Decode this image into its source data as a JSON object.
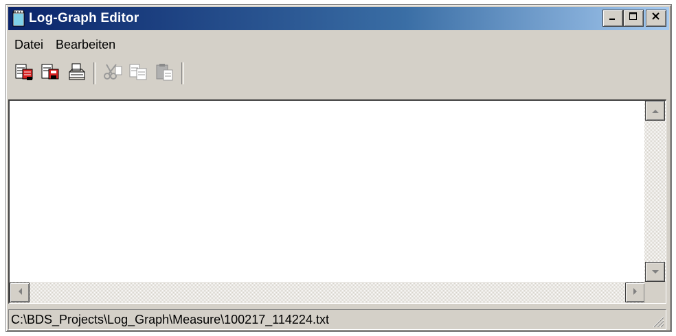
{
  "window": {
    "title": "Log-Graph Editor",
    "title_gradient": [
      "#0a246a",
      "#a6caf0"
    ],
    "controls": {
      "minimize": "minimize-icon",
      "maximize": "maximize-icon",
      "close": "close-icon"
    }
  },
  "menubar": {
    "items": [
      {
        "label": "Datei"
      },
      {
        "label": "Bearbeiten"
      }
    ]
  },
  "toolbar": {
    "groups": [
      [
        {
          "icon": "new-file-icon",
          "enabled": true
        },
        {
          "icon": "save-file-icon",
          "enabled": true
        },
        {
          "icon": "print-icon",
          "enabled": true
        }
      ],
      [
        {
          "icon": "cut-icon",
          "enabled": false
        },
        {
          "icon": "copy-icon",
          "enabled": false
        },
        {
          "icon": "paste-icon",
          "enabled": false
        }
      ]
    ]
  },
  "editor": {
    "content": ""
  },
  "statusbar": {
    "path": "C:\\BDS_Projects\\Log_Graph\\Measure\\100217_114224.txt"
  }
}
